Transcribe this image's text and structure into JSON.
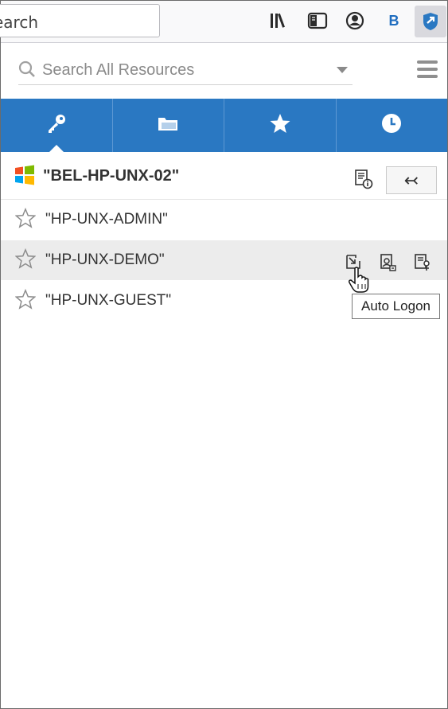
{
  "browser": {
    "url_fragment": "earch",
    "extension_letter": "B"
  },
  "search": {
    "placeholder": "Search All Resources"
  },
  "tabs": [
    {
      "icon": "key-icon",
      "active": true
    },
    {
      "icon": "folder-icon",
      "active": false
    },
    {
      "icon": "star-icon",
      "active": false
    },
    {
      "icon": "clock-icon",
      "active": false
    }
  ],
  "resource": {
    "title": "\"BEL-HP-UNX-02\"",
    "back_label": "↢"
  },
  "accounts": [
    {
      "name": "\"HP-UNX-ADMIN\""
    },
    {
      "name": "\"HP-UNX-DEMO\""
    },
    {
      "name": "\"HP-UNX-GUEST\""
    }
  ],
  "tooltip": {
    "text": "Auto Logon"
  },
  "colors": {
    "accent": "#2a78c2",
    "hover_row": "#ececec"
  }
}
